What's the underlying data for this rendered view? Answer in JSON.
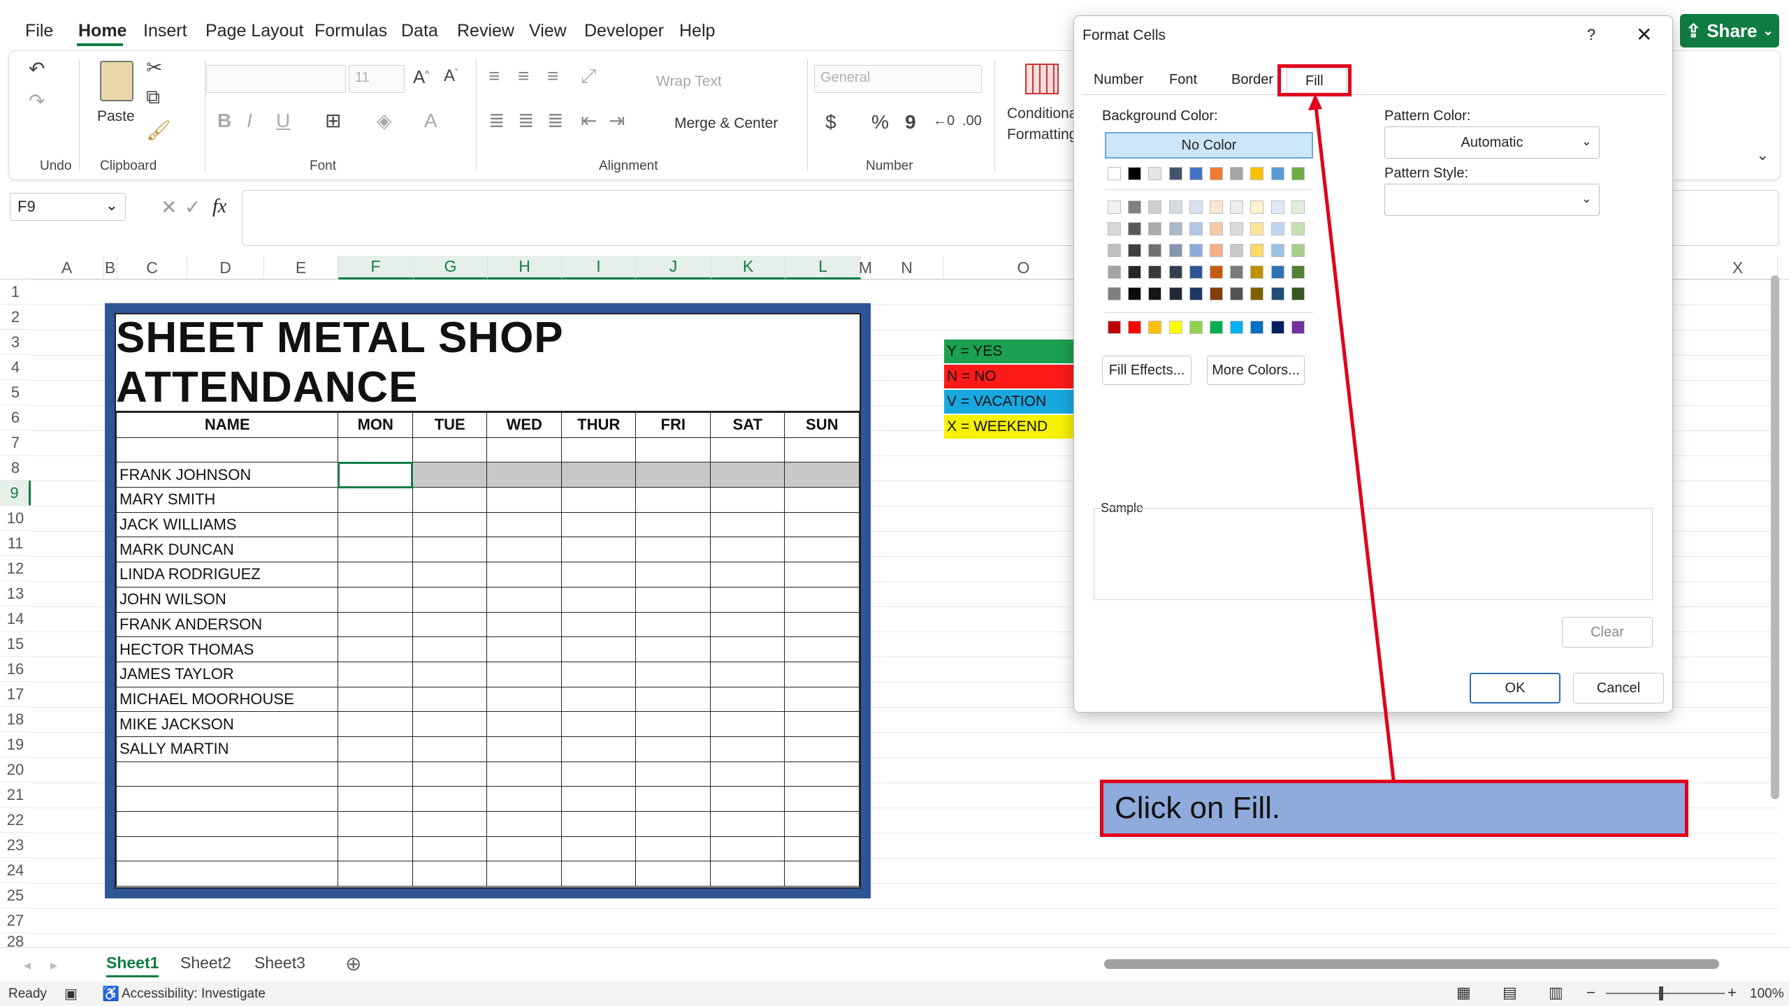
{
  "menu": {
    "items": [
      "File",
      "Home",
      "Insert",
      "Page Layout",
      "Formulas",
      "Data",
      "Review",
      "View",
      "Developer",
      "Help"
    ],
    "active": "Home",
    "share": "Share"
  },
  "ribbon": {
    "groups": {
      "undo": "Undo",
      "clipboard": "Clipboard",
      "font": "Font",
      "alignment": "Alignment",
      "number": "Number"
    },
    "paste": "Paste",
    "font_size": "11",
    "wrap_text": "Wrap Text",
    "merge_center": "Merge & Center",
    "number_format": "General",
    "conditional_formatting_1": "Conditional",
    "conditional_formatting_2": "Formatting",
    "bold": "B",
    "italic": "I",
    "underline": "U",
    "currency": "$",
    "percent": "%",
    "comma": "9"
  },
  "formula_bar": {
    "name_box": "F9",
    "fx": "fx"
  },
  "columns": [
    "A",
    "B",
    "C",
    "D",
    "E",
    "F",
    "G",
    "H",
    "I",
    "J",
    "K",
    "L",
    "M",
    "N",
    "O",
    "X"
  ],
  "rows": [
    "1",
    "2",
    "3",
    "4",
    "5",
    "6",
    "7",
    "8",
    "9",
    "10",
    "11",
    "12",
    "13",
    "14",
    "15",
    "16",
    "17",
    "18",
    "19",
    "20",
    "21",
    "22",
    "23",
    "24",
    "25",
    "27",
    "28"
  ],
  "sheet": {
    "title": "SHEET METAL SHOP ATTENDANCE",
    "headers": [
      "NAME",
      "MON",
      "TUE",
      "WED",
      "THUR",
      "FRI",
      "SAT",
      "SUN"
    ],
    "names": [
      "FRANK JOHNSON",
      "MARY SMITH",
      "JACK WILLIAMS",
      "MARK DUNCAN",
      "LINDA RODRIGUEZ",
      "JOHN WILSON",
      "FRANK ANDERSON",
      "HECTOR THOMAS",
      "JAMES TAYLOR",
      "MICHAEL MOORHOUSE",
      "MIKE JACKSON",
      "SALLY MARTIN"
    ],
    "legend": [
      {
        "text": "Y = YES",
        "color": "#1aa050"
      },
      {
        "text": "N = NO",
        "color": "#ff1a1a"
      },
      {
        "text": "V = VACATION",
        "color": "#18a8e0"
      },
      {
        "text": "X = WEEKEND",
        "color": "#f5f200"
      }
    ]
  },
  "dialog": {
    "title": "Format Cells",
    "help": "?",
    "tabs": [
      "Number",
      "Font",
      "Border",
      "Fill"
    ],
    "active_tab": "Fill",
    "background_color_label": "Background Color:",
    "no_color": "No Color",
    "fill_effects": "Fill Effects...",
    "more_colors": "More Colors...",
    "pattern_color_label": "Pattern Color:",
    "pattern_color_value": "Automatic",
    "pattern_style_label": "Pattern Style:",
    "sample_label": "Sample",
    "clear": "Clear",
    "ok": "OK",
    "cancel": "Cancel",
    "theme_row": [
      "#ffffff",
      "#000000",
      "#e7e6e6",
      "#44546a",
      "#4472c4",
      "#ed7d31",
      "#a5a5a5",
      "#ffc000",
      "#5b9bd5",
      "#70ad47"
    ],
    "shade_rows": [
      [
        "#f2f2f2",
        "#7f7f7f",
        "#d0cece",
        "#d6dce4",
        "#d9e2f3",
        "#fbe5d5",
        "#ededed",
        "#fff2cc",
        "#deebf6",
        "#e2efd9"
      ],
      [
        "#d8d8d8",
        "#595959",
        "#aeaaaa",
        "#adb9ca",
        "#b4c6e7",
        "#f7caac",
        "#dbdbdb",
        "#fee599",
        "#bdd7ee",
        "#c5e0b3"
      ],
      [
        "#bfbfbf",
        "#3f3f3f",
        "#757070",
        "#8496b0",
        "#8eaadb",
        "#f4b183",
        "#c9c9c9",
        "#ffd965",
        "#9cc3e5",
        "#a8d08d"
      ],
      [
        "#a5a5a5",
        "#262626",
        "#3a3838",
        "#323f4f",
        "#2f5496",
        "#c55a11",
        "#7b7b7b",
        "#bf9000",
        "#2e75b5",
        "#538135"
      ],
      [
        "#7f7f7f",
        "#0c0c0c",
        "#171616",
        "#222a35",
        "#1f3864",
        "#833c0b",
        "#525252",
        "#7f6000",
        "#1e4e79",
        "#375623"
      ]
    ],
    "standard_row": [
      "#c00000",
      "#ff0000",
      "#ffc000",
      "#ffff00",
      "#92d050",
      "#00b050",
      "#00b0f0",
      "#0070c0",
      "#002060",
      "#7030a0"
    ]
  },
  "annotation": {
    "text": "Click on Fill."
  },
  "sheets": {
    "tabs": [
      "Sheet1",
      "Sheet2",
      "Sheet3"
    ],
    "active": "Sheet1"
  },
  "status": {
    "ready": "Ready",
    "accessibility": "Accessibility: Investigate",
    "zoom": "100%"
  }
}
